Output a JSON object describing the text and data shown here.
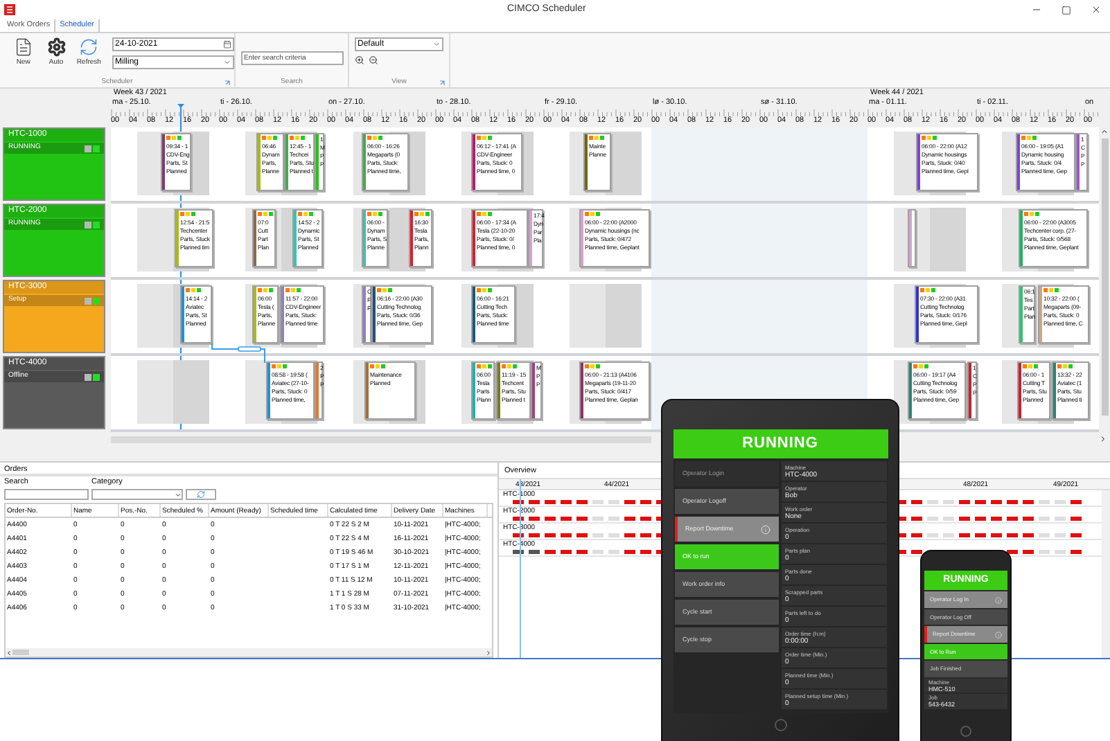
{
  "window": {
    "title": "CIMCO Scheduler"
  },
  "tabs": [
    {
      "label": "Work Orders",
      "selected": false
    },
    {
      "label": "Scheduler",
      "selected": true
    }
  ],
  "ribbon": {
    "buttons": [
      {
        "label": "New",
        "kind": "new"
      },
      {
        "label": "Auto",
        "kind": "auto"
      },
      {
        "label": "Refresh",
        "kind": "refresh"
      }
    ],
    "date": "24-10-2021",
    "process": "Milling",
    "search_placeholder": "Enter search criteria",
    "view": "Default",
    "groups": [
      "Scheduler",
      "Search",
      "View"
    ]
  },
  "timeline": {
    "weeks": [
      "Week 43 / 2021",
      "Week 44 / 2021"
    ],
    "days": [
      {
        "label": "ma - 25.10.",
        "hours": [
          "00",
          "04",
          "08",
          "12",
          "16",
          "20"
        ]
      },
      {
        "label": "ti - 26.10.",
        "hours": [
          "00",
          "04",
          "08",
          "12",
          "16",
          "20"
        ]
      },
      {
        "label": "on - 27.10.",
        "hours": [
          "00",
          "04",
          "08",
          "12",
          "16",
          "20"
        ]
      },
      {
        "label": "to - 28.10.",
        "hours": [
          "00",
          "04",
          "08",
          "12",
          "16",
          "20"
        ]
      },
      {
        "label": "fr - 29.10.",
        "hours": [
          "00",
          "04",
          "08",
          "12",
          "16",
          "20"
        ]
      },
      {
        "label": "lø - 30.10.",
        "hours": [
          "00",
          "04",
          "08",
          "12",
          "16",
          "20"
        ]
      },
      {
        "label": "sø - 31.10.",
        "hours": [
          "00",
          "04",
          "08",
          "12",
          "16",
          "20"
        ]
      },
      {
        "label": "ma - 01.11.",
        "hours": [
          "00",
          "04",
          "08",
          "12",
          "16",
          "20"
        ]
      },
      {
        "label": "ti - 02.11.",
        "hours": [
          "00",
          "04",
          "08",
          "12",
          "16",
          "20"
        ]
      },
      {
        "label": "on",
        "hours": [
          "00"
        ]
      }
    ]
  },
  "machines": [
    {
      "name": "HTC-1000",
      "status": "RUNNING",
      "color": "#22c414",
      "cards": [
        {
          "color": "#7a3d6e",
          "lines": [
            "09:34 - 1",
            "CDV-Eng",
            "Parts, St",
            "Planned"
          ]
        },
        {
          "color": "#a8b820",
          "lines": [
            "06:46",
            "Dynam",
            "Parts,",
            "Planne"
          ]
        },
        {
          "color": "#3cb043",
          "lines": [
            "12:45 - 1",
            "Techcei",
            "Parts, Stu",
            "Planned t"
          ]
        },
        {
          "color": "#22c414",
          "lines": [
            "1",
            "M",
            "P",
            "P"
          ]
        },
        {
          "color": "#3cb043",
          "lines": [
            "06:00 - 16:26",
            "Megaparts (0",
            "Parts, Stuck:",
            "Planned time,"
          ]
        },
        {
          "color": "#c0186b",
          "lines": [
            "06:12 - 17:41 (A",
            "CDV-Engineer",
            "Parts, Stuck: 0",
            "Planned time, 0"
          ]
        },
        {
          "color": "#6b6b10",
          "lines": [
            "Mainte",
            "Planne"
          ]
        },
        {
          "color": "#7b3fe0",
          "lines": [
            "06:00 - 22:00 (A12",
            "Dynamic housings",
            "Parts, Stuck: 0/40",
            "Planned time, Gepl"
          ]
        },
        {
          "color": "#7b3fe0",
          "lines": [
            "06:00 - 19:05 (A1",
            "Dynamic housing",
            "Parts, Stuck: 0/4",
            "Planned time, Gep"
          ]
        },
        {
          "color": "#a050d0",
          "lines": [
            "1",
            "C",
            "P",
            "P"
          ]
        }
      ]
    },
    {
      "name": "HTC-2000",
      "status": "RUNNING",
      "color": "#22c414",
      "cards": [
        {
          "color": "#a8b820",
          "lines": [
            "12:54 - 21:5",
            "Techcenter",
            "Parts, Stuck",
            "Planned tim"
          ]
        },
        {
          "color": "#8a6a50",
          "lines": [
            "07:0",
            "Cutt",
            "Part",
            "Plan"
          ]
        },
        {
          "color": "#3cc0b0",
          "lines": [
            "14:52 - 2",
            "Dynamic",
            "Parts, St",
            "Planned"
          ]
        },
        {
          "color": "#3cc0b0",
          "lines": [
            "06:00 -",
            "Dynam",
            "Parts, S",
            "Planne"
          ]
        },
        {
          "color": "#d82030",
          "lines": [
            "16:30",
            "Tesla",
            "Parts,",
            "Plann"
          ]
        },
        {
          "color": "#d82030",
          "lines": [
            "06:00 - 17:34 (A",
            "Tesla (22-10-20",
            "Parts, Stuck: 0/",
            "Planned time, 0"
          ]
        },
        {
          "color": "#d8a0d0",
          "lines": [
            "17:4",
            "Dyn",
            "Par",
            "Pla"
          ]
        },
        {
          "color": "#d8a0d0",
          "lines": [
            "06:00 - 22:00 (A2000",
            "Dynamic housings (nc",
            "Parts, Stuck: 0/472",
            "Planned time, Geplant"
          ]
        },
        {
          "color": "#d8a0d0"
        },
        {
          "color": "#20b060",
          "lines": [
            "06:00 - 22:00 (A3005",
            "Techcenter corp. (27-",
            "Parts, Stuck: 0/568",
            "Planned time, Geplant"
          ]
        }
      ]
    },
    {
      "name": "HTC-3000",
      "status": "Setup",
      "color": "#f5a81e",
      "cards": [
        {
          "color": "#1e90e0",
          "lines": [
            "14:14 - 2",
            "Aviatec",
            "Parts, St",
            "Planned"
          ]
        },
        {
          "color": "#a8b820",
          "lines": [
            "06:00",
            "Tesla (",
            "Parts,",
            "Planne"
          ]
        },
        {
          "color": "#9080c0",
          "lines": [
            "11:57 - 22:00",
            "CDV-Engineer",
            "Parts, Stuck:",
            "Planned time"
          ]
        },
        {
          "color": "#9080c0",
          "lines": [
            "C",
            "F",
            "F"
          ]
        },
        {
          "color": "#205080",
          "lines": [
            "06:16 - 22:00 (A30",
            "Cutting Technolog",
            "Parts, Stuck: 0/36",
            "Planned time, Gep"
          ]
        },
        {
          "color": "#1c5878",
          "lines": [
            "06:00 - 16:21",
            "Cutting Tech",
            "Parts, Stuck:",
            "Planned time"
          ]
        },
        {
          "color": "#3030d0",
          "lines": [
            "07:30 - 22:00 (A31",
            "Cutting Technolog",
            "Parts, Stuck: 0/176",
            "Planned time, Gepl"
          ]
        },
        {
          "color": "#30c070",
          "lines": [
            "06:1",
            "Tes",
            "Part",
            "Plan"
          ]
        },
        {
          "color": "#c8a880",
          "lines": [
            "10:32 - 22:00 (",
            "Megaparts (09-",
            "Parts, Stuck: 0",
            "Planned time, C"
          ]
        }
      ]
    },
    {
      "name": "HTC-4000",
      "status": "Offline",
      "color": "#5a5a5a",
      "cards": [
        {
          "color": "#1e90e0",
          "lines": [
            "08:58 - 19:58 (",
            "Aviatec (27-10-",
            "Parts, Stuck: 0",
            "Planned time,"
          ]
        },
        {
          "color": "#e07830",
          "lines": [
            "2",
            "P",
            "P"
          ]
        },
        {
          "color": "#a07040",
          "lines": [
            "Maintenance",
            "Planned"
          ]
        },
        {
          "color": "#20b0b0",
          "lines": [
            "06:00",
            "Tesla",
            "Parts",
            "Plann"
          ]
        },
        {
          "color": "#7a7a20",
          "lines": [
            "11:19 - 15",
            "Techcent",
            "Parts, Stu",
            "Planned t"
          ]
        },
        {
          "color": "#a04080",
          "lines": [
            "M",
            "P",
            "P"
          ]
        },
        {
          "color": "#903060",
          "lines": [
            "06:00 - 21:13 (A4106",
            "Megaparts (19-11-20",
            "Parts, Stuck: 0/417",
            "Planned time, Geplan"
          ]
        },
        {
          "color": "#208870",
          "lines": [
            "06:00 - 19:17 (A4",
            "Cutting Technolog",
            "Parts, Stuck: 0/59",
            "Planned time, Gep"
          ]
        },
        {
          "color": "#c82030",
          "lines": [
            "1",
            "C",
            "P",
            "P"
          ]
        },
        {
          "color": "#c82030",
          "lines": [
            "06:00 - 1",
            "Cutting T",
            "Parts, Stu",
            "Planned"
          ]
        },
        {
          "color": "#208870",
          "lines": [
            "13:32 - 22",
            "Aviatec (1",
            "Parts, Stu",
            "Planned ti"
          ]
        }
      ]
    }
  ],
  "orders": {
    "title": "Orders",
    "search_label": "Search",
    "category_label": "Category",
    "columns": [
      "Order-No.",
      "Name",
      "Pos.-No.",
      "Scheduled %",
      "Amount (Ready)",
      "Scheduled time",
      "Calculated time",
      "Delivery Date",
      "Machines"
    ],
    "rows": [
      [
        "A4400",
        "0",
        "0",
        "0",
        "0",
        "",
        "0 T 22 S 2 M",
        "10-11-2021",
        "|HTC-4000;"
      ],
      [
        "A4401",
        "0",
        "0",
        "0",
        "0",
        "",
        "0 T 22 S 4 M",
        "16-11-2021",
        "|HTC-4000;"
      ],
      [
        "A4402",
        "0",
        "0",
        "0",
        "0",
        "",
        "0 T 19 S 46 M",
        "30-10-2021",
        "|HTC-4000;"
      ],
      [
        "A4403",
        "0",
        "0",
        "0",
        "0",
        "",
        "0 T 17 S 1 M",
        "12-11-2021",
        "|HTC-4000;"
      ],
      [
        "A4404",
        "0",
        "0",
        "0",
        "0",
        "",
        "0 T 11 S 12 M",
        "10-11-2021",
        "|HTC-4000;"
      ],
      [
        "A4405",
        "0",
        "0",
        "0",
        "0",
        "",
        "1 T 1 S 28 M",
        "07-11-2021",
        "|HTC-4000;"
      ],
      [
        "A4406",
        "0",
        "0",
        "0",
        "0",
        "",
        "1 T 0 S 33 M",
        "31-10-2021",
        "|HTC-4000;"
      ]
    ]
  },
  "overview": {
    "title": "Overview",
    "weeks": [
      "43/2021",
      "44/2021",
      "48/2021",
      "49/2021"
    ],
    "machines": [
      "HTC-1000",
      "HTC-2000",
      "HTC-3000",
      "HTC-4000"
    ]
  },
  "tablet": {
    "status": "RUNNING",
    "buttons": [
      {
        "label": "Operator Login",
        "kind": "disabled"
      },
      {
        "label": "Operator Logoff",
        "kind": "normal"
      },
      {
        "label": "Report Downtime",
        "kind": "alert"
      },
      {
        "label": "OK to run",
        "kind": "ok"
      },
      {
        "label": "Work order info",
        "kind": "normal"
      },
      {
        "label": "Cycle start",
        "kind": "normal"
      },
      {
        "label": "Cycle stop",
        "kind": "normal"
      }
    ],
    "fields": [
      {
        "label": "Machine",
        "value": "HTC-4000"
      },
      {
        "label": "Operator",
        "value": "Bob"
      },
      {
        "label": "Work order",
        "value": "None"
      },
      {
        "label": "Operation",
        "value": "0"
      },
      {
        "label": "Parts plan",
        "value": "0"
      },
      {
        "label": "Parts done",
        "value": "0"
      },
      {
        "label": "Scrapped parts",
        "value": "0"
      },
      {
        "label": "Parts left to do",
        "value": "0"
      },
      {
        "label": "Order time (h:m)",
        "value": "0:00:00"
      },
      {
        "label": "Order time (Min.)",
        "value": "0"
      },
      {
        "label": "Planned time (Min.)",
        "value": "0"
      },
      {
        "label": "Planned setup time (Min.)",
        "value": "0"
      }
    ]
  },
  "phone": {
    "status": "RUNNING",
    "buttons": [
      {
        "label": "Operator Log In",
        "kind": "info"
      },
      {
        "label": "Operator Log Off",
        "kind": "normal"
      },
      {
        "label": "Report Downtime",
        "kind": "alert"
      },
      {
        "label": "OK to Run",
        "kind": "ok"
      },
      {
        "label": "Job Finished",
        "kind": "normal"
      }
    ],
    "fields": [
      {
        "label": "Machine",
        "value": "HMC-510"
      },
      {
        "label": "Job",
        "value": "543-6432"
      }
    ]
  }
}
